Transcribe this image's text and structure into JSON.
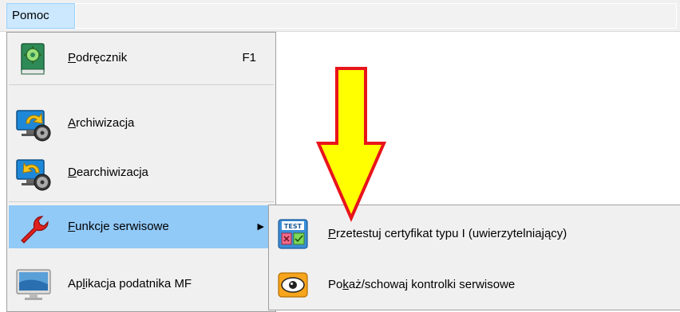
{
  "menubar": {
    "active_menu": "Pomoc"
  },
  "menu": {
    "items": [
      {
        "pre": "",
        "acc": "P",
        "post": "odręcznik",
        "shortcut": "F1",
        "icon": "manual-book-gear-icon"
      },
      {
        "pre": "",
        "acc": "A",
        "post": "rchiwizacja",
        "shortcut": "",
        "icon": "archive-monitor-disc-icon"
      },
      {
        "pre": "",
        "acc": "D",
        "post": "earchiwizacja",
        "shortcut": "",
        "icon": "restore-monitor-disc-icon"
      },
      {
        "pre": "",
        "acc": "F",
        "post": "unkcje serwisowe",
        "shortcut": "",
        "icon": "wrench-icon",
        "submenu_arrow": "▶"
      },
      {
        "pre": "Ap",
        "acc": "l",
        "post": "ikacja podatnika MF",
        "shortcut": "",
        "icon": "computer-monitor-icon"
      }
    ]
  },
  "submenu": {
    "items": [
      {
        "pre": "",
        "acc": "P",
        "post": "rzetestuj certyfikat typu I (uwierzytelniający)",
        "icon": "test-certificate-icon",
        "icon_text": "TEST"
      },
      {
        "pre": "Po",
        "acc": "k",
        "post": "aż/schowaj kontrolki serwisowe",
        "icon": "eye-icon"
      }
    ]
  },
  "colors": {
    "menu_background": "#f0f0f0",
    "highlight": "#91c9f7",
    "menubar_highlight": "#cce8ff",
    "arrow_fill": "#ffff00",
    "arrow_stroke": "#e8141b"
  }
}
